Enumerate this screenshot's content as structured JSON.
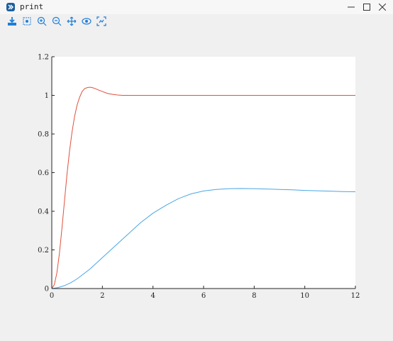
{
  "window": {
    "title": "print"
  },
  "toolbar": {
    "tools": [
      "save-icon",
      "data-cursor-icon",
      "zoom-in-icon",
      "zoom-out-icon",
      "pan-icon",
      "rotate-icon",
      "restore-view-icon"
    ]
  },
  "colors": {
    "series_red": "#e0503c",
    "series_blue": "#4aa6e6",
    "axes_bg": "#ffffff",
    "icon_blue": "#1e7ed8"
  },
  "chart_data": {
    "type": "line",
    "xlim": [
      0,
      12
    ],
    "ylim": [
      0,
      1.2
    ],
    "xticks": [
      "0",
      "2",
      "4",
      "6",
      "8",
      "10",
      "12"
    ],
    "yticks": [
      "0",
      "0.2",
      "0.4",
      "0.6",
      "0.8",
      "1",
      "1.2"
    ],
    "grid": false,
    "series": [
      {
        "color": "#e0503c",
        "x": [
          0,
          0.1,
          0.2,
          0.3,
          0.4,
          0.5,
          0.6,
          0.7,
          0.8,
          0.9,
          1.0,
          1.1,
          1.2,
          1.3,
          1.4,
          1.5,
          1.6,
          1.7,
          1.8,
          1.9,
          2.0,
          2.2,
          2.4,
          2.6,
          2.8,
          3.0,
          3.5,
          4,
          5,
          6,
          7,
          8,
          9,
          10,
          11,
          12
        ],
        "y": [
          0,
          0.02,
          0.08,
          0.18,
          0.31,
          0.45,
          0.59,
          0.71,
          0.81,
          0.89,
          0.95,
          0.99,
          1.02,
          1.035,
          1.04,
          1.042,
          1.04,
          1.036,
          1.03,
          1.025,
          1.02,
          1.01,
          1.005,
          1.002,
          1.0,
          1.0,
          1.0,
          1.0,
          1.0,
          1.0,
          1.0,
          1.0,
          1.0,
          1.0,
          1.0,
          1.0
        ]
      },
      {
        "color": "#4aa6e6",
        "x": [
          0,
          0.25,
          0.5,
          0.75,
          1.0,
          1.5,
          2.0,
          2.5,
          3.0,
          3.5,
          4.0,
          4.5,
          5.0,
          5.5,
          6.0,
          6.5,
          7.0,
          7.5,
          8.0,
          8.5,
          9.0,
          9.5,
          10.0,
          10.5,
          11.0,
          11.5,
          12.0
        ],
        "y": [
          0,
          0.005,
          0.015,
          0.03,
          0.05,
          0.1,
          0.16,
          0.22,
          0.28,
          0.34,
          0.39,
          0.43,
          0.465,
          0.49,
          0.505,
          0.513,
          0.517,
          0.518,
          0.517,
          0.515,
          0.513,
          0.511,
          0.508,
          0.506,
          0.504,
          0.502,
          0.501
        ]
      }
    ]
  }
}
